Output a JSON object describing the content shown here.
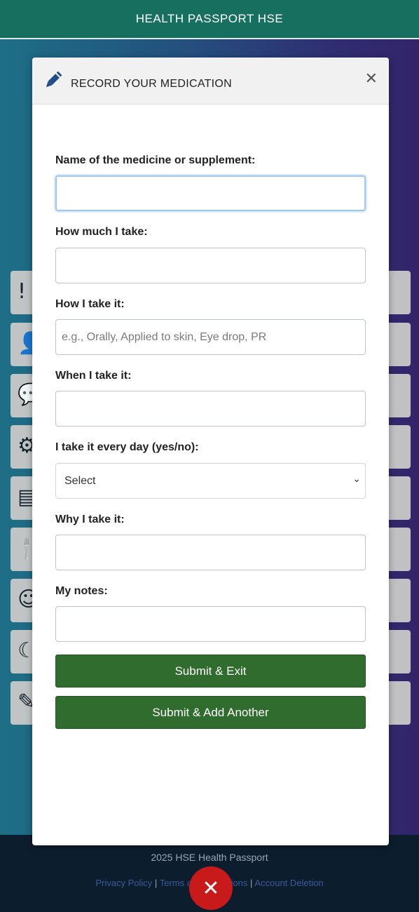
{
  "app": {
    "title": "HEALTH PASSPORT HSE"
  },
  "background_tiles": [
    {
      "icon": "exclamation-icon"
    },
    {
      "icon": "user-icon"
    },
    {
      "icon": "chat-icon"
    },
    {
      "icon": "gear-icon"
    },
    {
      "icon": "calendar-icon"
    },
    {
      "icon": "fork-icon"
    },
    {
      "icon": "smile-icon"
    },
    {
      "icon": "moon-icon"
    },
    {
      "icon": "edit-icon"
    }
  ],
  "modal": {
    "title": "RECORD YOUR MEDICATION",
    "fields": {
      "name_label": "Name of the medicine or supplement:",
      "amount_label": "How much I take:",
      "method_label": "How I take it:",
      "method_placeholder": "e.g., Orally, Applied to skin, Eye drop, PR",
      "when_label": "When I take it:",
      "daily_label": "I take it every day (yes/no):",
      "daily_selected": "Select",
      "why_label": "Why I take it:",
      "notes_label": "My notes:"
    },
    "buttons": {
      "submit_exit": "Submit & Exit",
      "submit_add": "Submit & Add Another"
    }
  },
  "footer": {
    "copyright": "2025 HSE Health Passport",
    "links": [
      "Privacy Policy",
      "Terms and Conditions",
      "Account Deletion"
    ],
    "separator": "|"
  },
  "colors": {
    "header": "#17705f",
    "button": "#2f6c2d",
    "close_fab": "#c8191b"
  }
}
